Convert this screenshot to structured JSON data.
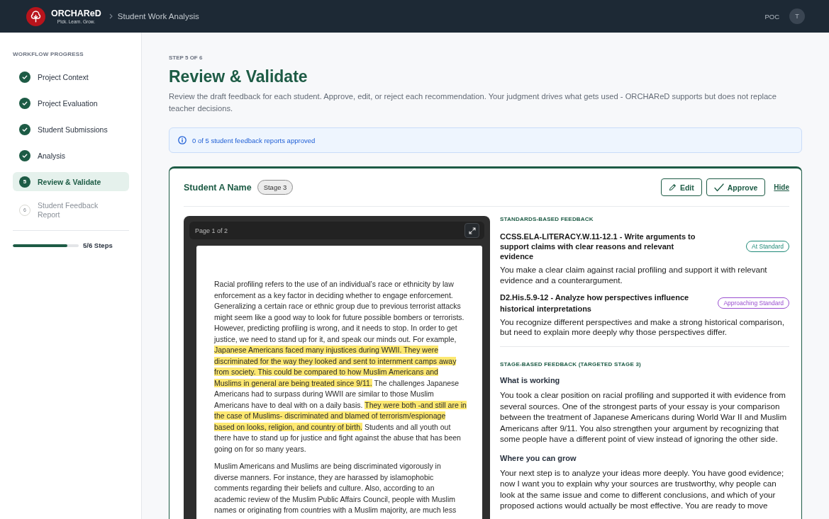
{
  "topbar": {
    "brand": "ORCHAReD",
    "tagline": "Pick. Learn. Grow.",
    "breadcrumb": "Student Work Analysis",
    "user_label": "POC",
    "avatar_initial": "T"
  },
  "sidebar": {
    "heading": "WORKFLOW PROGRESS",
    "steps": [
      {
        "label": "Project Context",
        "completed": true,
        "selected": false
      },
      {
        "label": "Project Evaluation",
        "completed": true,
        "selected": false
      },
      {
        "label": "Student Submissions",
        "completed": true,
        "selected": false
      },
      {
        "label": "Analysis",
        "completed": true,
        "selected": false
      },
      {
        "label": "Review & Validate",
        "completed": false,
        "number": "5",
        "selected": true
      },
      {
        "label": "Student Feedback Report",
        "completed": false,
        "number": "6",
        "selected": false
      }
    ],
    "progress": {
      "level": 0.833,
      "label": "5/6 Steps"
    }
  },
  "page": {
    "eyebrow": "STEP 5 OF 6",
    "title": "Review & Validate",
    "description": "Review the draft feedback for each student. Approve, edit, or reject each recommendation. Your judgment drives what gets used - ORCHAReD supports but does not replace teacher decisions."
  },
  "notice": {
    "text": "0 of 5 student feedback reports approved"
  },
  "student_card": {
    "name": "Student A Name",
    "stage": "Stage 3",
    "actions": [
      {
        "label": "Edit",
        "kind": "edit"
      },
      {
        "label": "Approve",
        "kind": "approve"
      },
      {
        "label": "Hide",
        "kind": "link"
      }
    ],
    "document": {
      "page_label": "Page 1 of 2",
      "paragraphs": [
        {
          "segments": [
            {
              "text": "Racial profiling refers to the use of an individual’s race or ethnicity by law enforcement as a key factor in deciding whether to engage enforcement. Generalizing a certain race or ethnic group due to previous terrorist attacks might seem like a good way to look for future possible bombers or terrorists. However, predicting profiling is wrong, and it needs to stop. In order to get justice, we need to stand up for it, and speak our minds out. For example, ",
              "highlighted": false
            },
            {
              "text": "Japanese Americans faced many injustices during WWII. They were discriminated for the way they looked and sent to internment camps away from society. This could be compared to how Muslim Americans and Muslims in general are being treated since 9/11.",
              "highlighted": true
            },
            {
              "text": " The challenges Japanese Americans had to surpass during WWII are similar to those Muslim Americans have to deal with on a daily basis. ",
              "highlighted": false
            },
            {
              "text": "They were both -and still are in the case of Muslims- discriminated and blamed of terrorism/espionage based on looks, religion, and country of birth.",
              "highlighted": true
            },
            {
              "text": " Students and all youth out there have to stand up for justice and fight against the abuse that has been going on for so many years.",
              "highlighted": false
            }
          ]
        },
        {
          "segments": [
            {
              "text": "Muslim Americans and Muslims are being discriminated vigorously in diverse manners. For instance, they are harassed by islamophobic comments regarding their beliefs and culture. Also, according to an academic review of the Muslim Public Affairs Council, people with Muslim names or originating from countries with a Muslim majority, are much less",
              "highlighted": false
            }
          ]
        }
      ]
    },
    "standards_heading": "STANDARDS-BASED FEEDBACK",
    "standards": [
      {
        "title": "CCSS.ELA-LITERACY.W.11-12.1 - Write arguments to support claims with clear reasons and relevant evidence",
        "rating": "At Standard",
        "color": "#1f8a78",
        "feedback": "You make a clear claim against racial profiling and support it with relevant evidence and a counterargument."
      },
      {
        "title": "D2.His.5.9-12 - Analyze how perspectives influence historical interpretations",
        "rating": "Approaching Standard",
        "color": "#9a4fd0",
        "feedback": "You recognize different perspectives and make a strong historical comparison, but need to explain more deeply why those perspectives differ."
      }
    ],
    "stage_heading": "STAGE-BASED FEEDBACK (TARGETED STAGE 3)",
    "sections": [
      {
        "heading": "What is working",
        "text": "You took a clear position on racial profiling and supported it with evidence from several sources. One of the strongest parts of your essay is your comparison between the treatment of Japanese Americans during World War II and Muslim Americans after 9/11. You also strengthen your argument by recognizing that some people have a different point of view instead of ignoring the other side."
      },
      {
        "heading": "Where you can grow",
        "text": "Your next step is to analyze your ideas more deeply. You have good evidence; now I want you to explain why your sources are trustworthy, why people can look at the same issue and come to different conclusions, and which of your proposed actions would actually be most effective. You are ready to move"
      }
    ]
  }
}
